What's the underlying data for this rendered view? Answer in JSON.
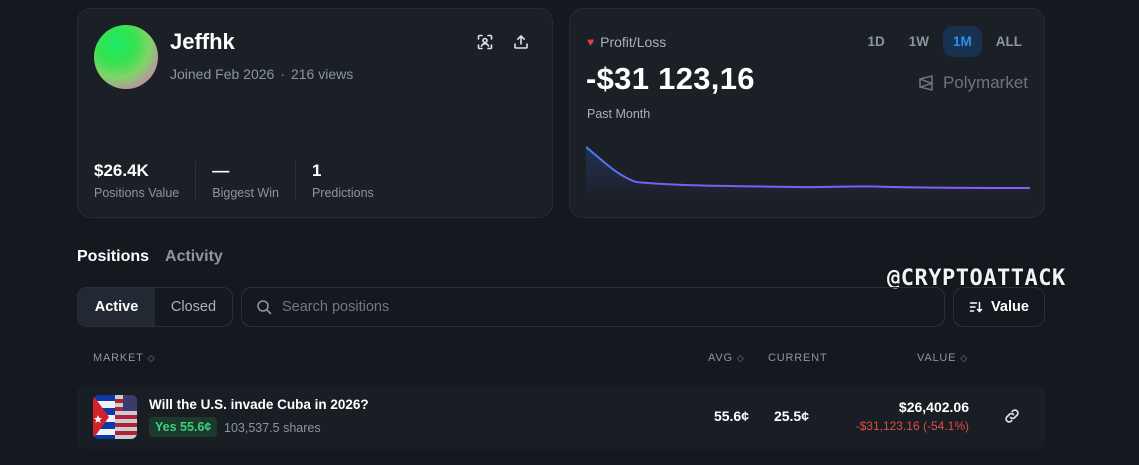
{
  "profile": {
    "username": "Jeffhk",
    "joined": "Joined Feb 2026",
    "separator": "·",
    "views": "216 views",
    "stats": [
      {
        "value": "$26.4K",
        "label": "Positions Value"
      },
      {
        "value": "—",
        "label": "Biggest Win"
      },
      {
        "value": "1",
        "label": "Predictions"
      }
    ]
  },
  "pnl": {
    "label": "Profit/Loss",
    "value": "-$31 123,16",
    "period": "Past Month",
    "range_tabs": [
      "1D",
      "1W",
      "1M",
      "ALL"
    ],
    "active_range": "1M",
    "brand": "Polymarket"
  },
  "sections": {
    "tabs": [
      "Positions",
      "Activity"
    ],
    "active": "Positions"
  },
  "watermark": "@CRYPTOATTACK",
  "filters": {
    "segments": [
      "Active",
      "Closed"
    ],
    "active": "Active",
    "search_placeholder": "Search positions",
    "sort_label": "Value"
  },
  "table": {
    "headers": {
      "market": "MARKET",
      "avg": "AVG",
      "current": "CURRENT",
      "value": "VALUE"
    },
    "rows": [
      {
        "title": "Will the U.S. invade Cuba in 2026?",
        "outcome": "Yes 55.6¢",
        "shares": "103,537.5 shares",
        "avg": "55.6¢",
        "current": "25.5¢",
        "value": "$26,402.06",
        "change": "-$31,123.16 (-54.1%)"
      }
    ]
  },
  "colors": {
    "accent": "#2f8ff0",
    "loss": "#e34b45",
    "gain": "#3fcf7f",
    "chart_line": "#8b5cf6"
  }
}
